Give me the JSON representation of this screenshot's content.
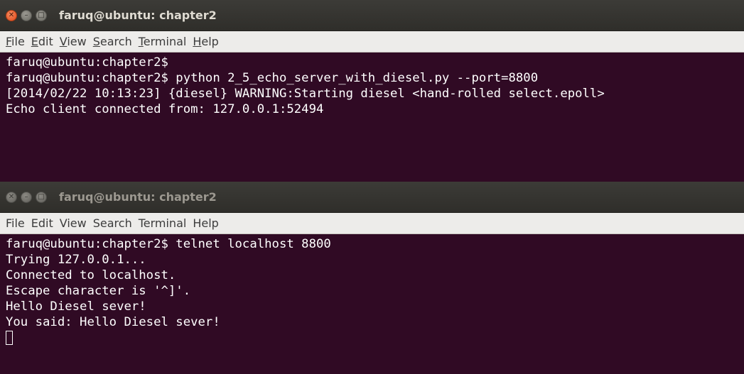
{
  "top_terminal": {
    "title": "faruq@ubuntu: chapter2",
    "menu": [
      {
        "label": "File"
      },
      {
        "label": "Edit"
      },
      {
        "label": "View"
      },
      {
        "label": "Search"
      },
      {
        "label": "Terminal"
      },
      {
        "label": "Help"
      }
    ],
    "lines": [
      "faruq@ubuntu:chapter2$",
      "faruq@ubuntu:chapter2$ python 2_5_echo_server_with_diesel.py --port=8800",
      "[2014/02/22 10:13:23] {diesel} WARNING:Starting diesel <hand-rolled select.epoll>",
      "Echo client connected from: 127.0.0.1:52494"
    ]
  },
  "bottom_terminal": {
    "title": "faruq@ubuntu: chapter2",
    "menu": [
      {
        "label": "File"
      },
      {
        "label": "Edit"
      },
      {
        "label": "View"
      },
      {
        "label": "Search"
      },
      {
        "label": "Terminal"
      },
      {
        "label": "Help"
      }
    ],
    "lines": [
      "faruq@ubuntu:chapter2$ telnet localhost 8800",
      "Trying 127.0.0.1...",
      "Connected to localhost.",
      "Escape character is '^]'.",
      "Hello Diesel sever!",
      "You said: Hello Diesel sever!"
    ]
  },
  "colors": {
    "terminal_bg": "#300a24",
    "terminal_fg": "#ffffff",
    "titlebar_bg": "#3c3b37",
    "close_button": "#e0491a"
  },
  "icons": {
    "close": "close-icon",
    "minimize": "minimize-icon",
    "maximize": "maximize-icon"
  }
}
